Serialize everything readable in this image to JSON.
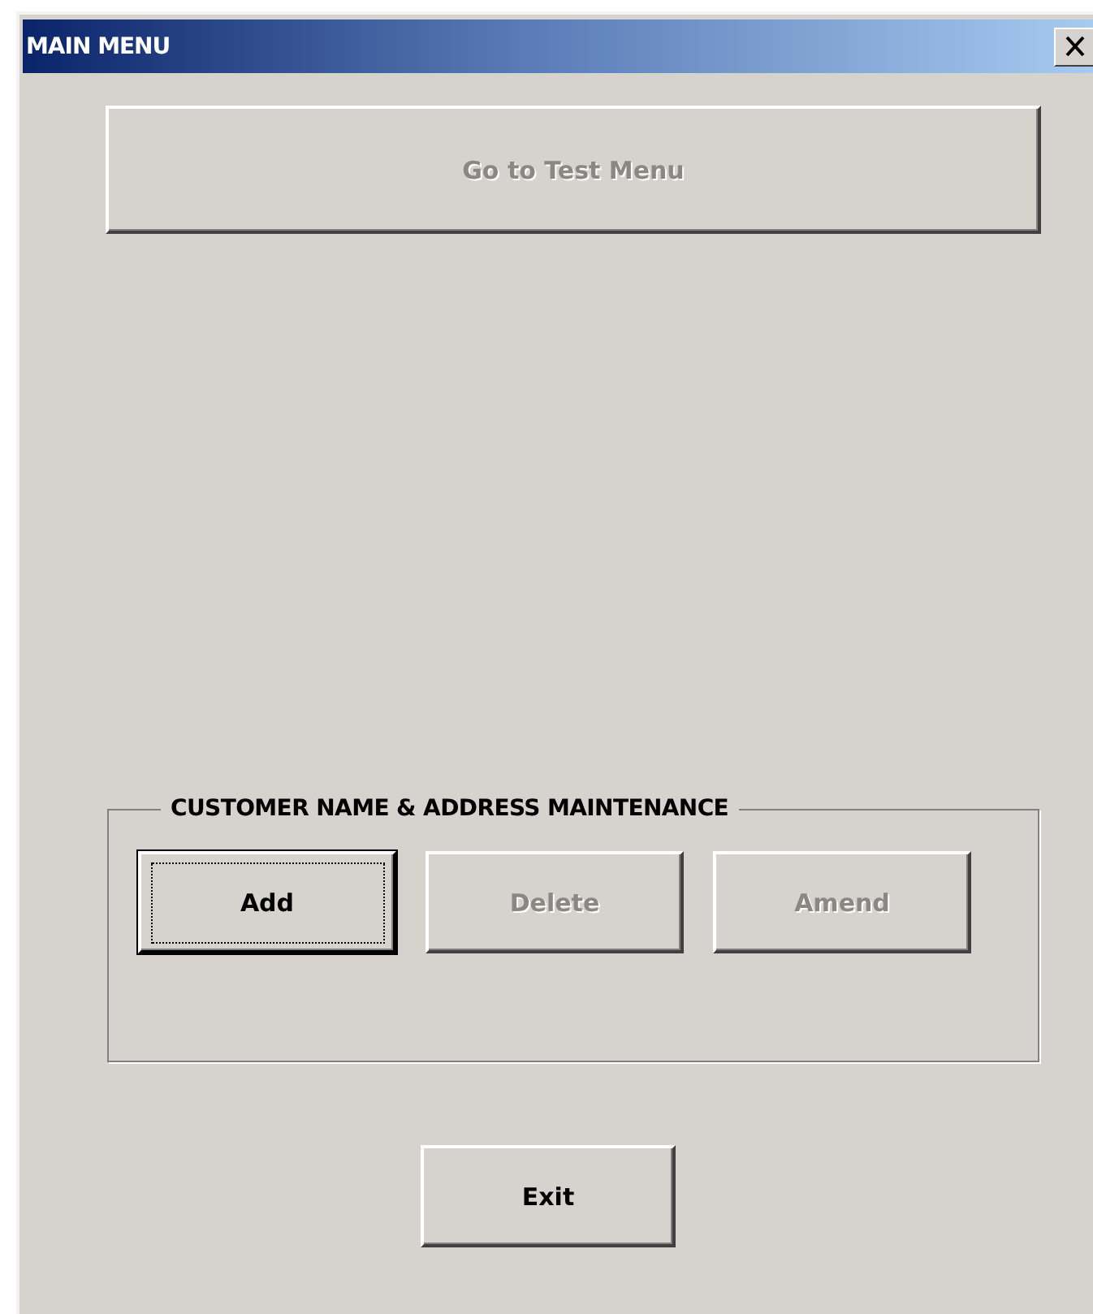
{
  "window": {
    "title": "MAIN MENU"
  },
  "top_button": {
    "label": "Go to Test Menu",
    "disabled": true,
    "focused": false
  },
  "group": {
    "title": "CUSTOMER NAME & ADDRESS MAINTENANCE",
    "buttons": [
      {
        "label": "Add",
        "disabled": false,
        "focused": true
      },
      {
        "label": "Delete",
        "disabled": true,
        "focused": false
      },
      {
        "label": "Amend",
        "disabled": true,
        "focused": false
      }
    ]
  },
  "exit_button": {
    "label": "Exit",
    "disabled": false,
    "focused": false
  }
}
